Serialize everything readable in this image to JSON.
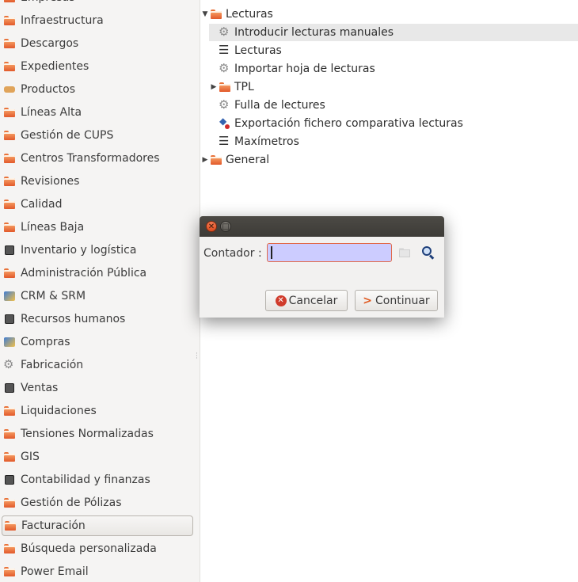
{
  "sidebar": {
    "items": [
      {
        "label": "Empresas",
        "icon": "folder"
      },
      {
        "label": "Infraestructura",
        "icon": "folder"
      },
      {
        "label": "Descargos",
        "icon": "folder"
      },
      {
        "label": "Expedientes",
        "icon": "folder"
      },
      {
        "label": "Productos",
        "icon": "box"
      },
      {
        "label": "Líneas Alta",
        "icon": "folder"
      },
      {
        "label": "Gestión de CUPS",
        "icon": "folder"
      },
      {
        "label": "Centros Transformadores",
        "icon": "folder"
      },
      {
        "label": "Revisiones",
        "icon": "folder"
      },
      {
        "label": "Calidad",
        "icon": "folder"
      },
      {
        "label": "Líneas Baja",
        "icon": "folder"
      },
      {
        "label": "Inventario y logística",
        "icon": "grid"
      },
      {
        "label": "Administración Pública",
        "icon": "folder"
      },
      {
        "label": "CRM & SRM",
        "icon": "chart"
      },
      {
        "label": "Recursos humanos",
        "icon": "grid"
      },
      {
        "label": "Compras",
        "icon": "chart"
      },
      {
        "label": "Fabricación",
        "icon": "gear"
      },
      {
        "label": "Ventas",
        "icon": "grid"
      },
      {
        "label": "Liquidaciones",
        "icon": "folder"
      },
      {
        "label": "Tensiones Normalizadas",
        "icon": "folder"
      },
      {
        "label": "GIS",
        "icon": "folder"
      },
      {
        "label": "Contabilidad y finanzas",
        "icon": "grid"
      },
      {
        "label": "Gestión de Pólizas",
        "icon": "folder"
      },
      {
        "label": "Facturación",
        "icon": "folder",
        "selected": true
      },
      {
        "label": "Búsqueda personalizada",
        "icon": "folder"
      },
      {
        "label": "Power Email",
        "icon": "folder"
      }
    ]
  },
  "tree": {
    "rows": [
      {
        "label": "Lecturas",
        "icon": "folder",
        "expander": "▼",
        "level": 0
      },
      {
        "label": "Introducir lecturas manuales",
        "icon": "gear",
        "level": 1,
        "highlight": true
      },
      {
        "label": "Lecturas",
        "icon": "list",
        "level": 1
      },
      {
        "label": "Importar hoja de lecturas",
        "icon": "gear",
        "level": 1
      },
      {
        "label": "TPL",
        "icon": "folder",
        "expander": "▶",
        "level": 1
      },
      {
        "label": "Fulla de lectures",
        "icon": "gear",
        "level": 1
      },
      {
        "label": "Exportación fichero comparativa lecturas",
        "icon": "export",
        "level": 1
      },
      {
        "label": "Maxímetros",
        "icon": "list",
        "level": 1
      },
      {
        "label": "General",
        "icon": "folder",
        "expander": "▶",
        "level": 0
      }
    ]
  },
  "dialog": {
    "field_label": "Contador :",
    "field_value": "",
    "cancel_label": "Cancelar",
    "continue_label": "Continuar",
    "close_glyph": "✕",
    "maximize_glyph": "□"
  }
}
